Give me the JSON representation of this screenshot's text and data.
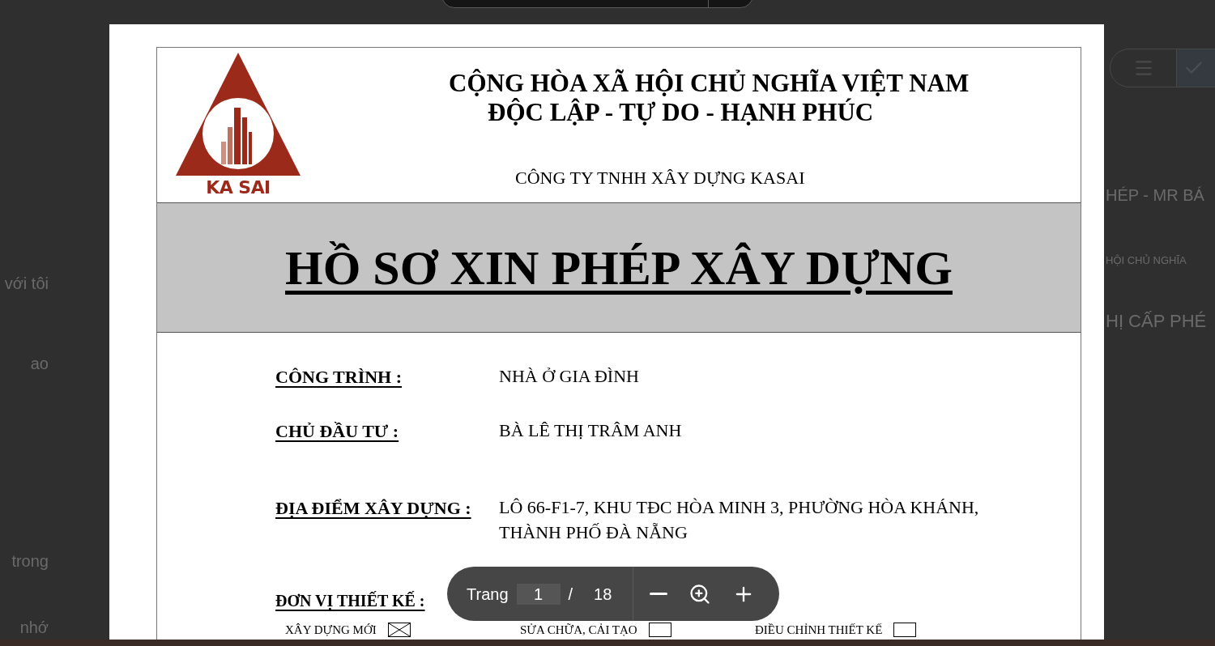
{
  "background": {
    "left_texts": [
      "với tôi",
      "ao",
      "trong",
      "nhớ"
    ],
    "right_texts": [
      "HÉP - MR BÁ",
      "HỘI CHỦ NGHĨA",
      "HỊ CẤP PHÉ"
    ]
  },
  "document": {
    "logo_text": "KA SAI",
    "header_lines": [
      "CỘNG HÒA XÃ HỘI CHỦ NGHĨA VIỆT NAM",
      "ĐỘC LẬP - TỰ DO - HẠNH PHÚC"
    ],
    "company": "CÔNG TY TNHH XÂY DỰNG KASAI",
    "title": "HỒ SƠ XIN PHÉP XÂY DỰNG",
    "fields": [
      {
        "label": "CÔNG TRÌNH :",
        "value": "NHÀ Ở GIA ĐÌNH"
      },
      {
        "label": "CHỦ ĐẦU TƯ :",
        "value": "BÀ LÊ THỊ TRÂM ANH"
      },
      {
        "label": "ĐỊA ĐIỂM XÂY DỰNG :",
        "value": "LÔ 66-F1-7, KHU TĐC HÒA MINH 3, PHƯỜNG HÒA KHÁNH, THÀNH PHỐ ĐÀ NẴNG"
      },
      {
        "label": "ĐƠN VỊ THIẾT KẾ :"
      }
    ],
    "options": [
      {
        "label": "XÂY DỰNG MỚI",
        "checked": true
      },
      {
        "label": "SỬA CHỮA, CẢI TẠO",
        "checked": false
      },
      {
        "label": "ĐIỀU CHỈNH THIẾT KẾ",
        "checked": false
      }
    ]
  },
  "page_toolbar": {
    "label": "Trang",
    "page": "1",
    "separator": "/",
    "total": "18"
  }
}
